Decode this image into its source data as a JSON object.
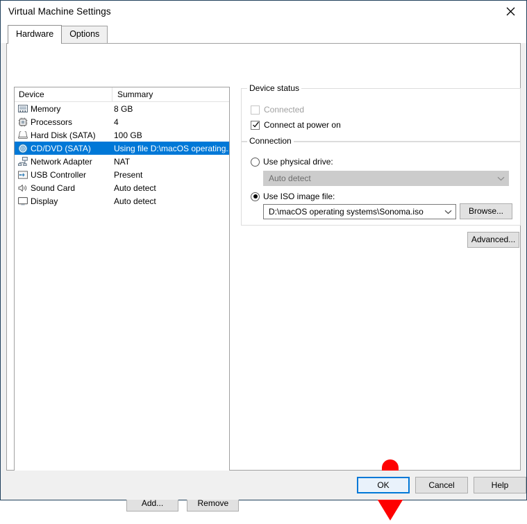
{
  "window": {
    "title": "Virtual Machine Settings",
    "close_icon": "close-icon",
    "accent_color": "#0078d7",
    "titlebar_border_color": "#20405c"
  },
  "tabs": [
    {
      "label": "Hardware",
      "active": true
    },
    {
      "label": "Options",
      "active": false
    }
  ],
  "device_list": {
    "columns": [
      "Device",
      "Summary"
    ],
    "rows": [
      {
        "icon": "memory-icon",
        "device": "Memory",
        "summary": "8 GB",
        "selected": false
      },
      {
        "icon": "processor-icon",
        "device": "Processors",
        "summary": "4",
        "selected": false
      },
      {
        "icon": "hard-disk-icon",
        "device": "Hard Disk (SATA)",
        "summary": "100 GB",
        "selected": false
      },
      {
        "icon": "cd-dvd-icon",
        "device": "CD/DVD (SATA)",
        "summary": "Using file D:\\macOS operating...",
        "selected": true
      },
      {
        "icon": "network-adapter-icon",
        "device": "Network Adapter",
        "summary": "NAT",
        "selected": false
      },
      {
        "icon": "usb-controller-icon",
        "device": "USB Controller",
        "summary": "Present",
        "selected": false
      },
      {
        "icon": "sound-card-icon",
        "device": "Sound Card",
        "summary": "Auto detect",
        "selected": false
      },
      {
        "icon": "display-icon",
        "device": "Display",
        "summary": "Auto detect",
        "selected": false
      }
    ],
    "add_label": "Add...",
    "remove_label": "Remove"
  },
  "device_status": {
    "group_title": "Device status",
    "connected": {
      "label": "Connected",
      "checked": false,
      "enabled": false
    },
    "connect_at_power_on": {
      "label": "Connect at power on",
      "checked": true,
      "enabled": true
    }
  },
  "connection": {
    "group_title": "Connection",
    "use_physical_drive": {
      "label": "Use physical drive:",
      "selected": false
    },
    "physical_drive_value": "Auto detect",
    "use_iso_image": {
      "label": "Use ISO image file:",
      "selected": true
    },
    "iso_path": "D:\\macOS operating systems\\Sonoma.iso",
    "browse_label": "Browse...",
    "advanced_label": "Advanced..."
  },
  "footer": {
    "ok_label": "OK",
    "cancel_label": "Cancel",
    "help_label": "Help"
  },
  "annotation": {
    "arrow": "down-arrow-annotation",
    "color": "#fe0000",
    "points_at": "OK"
  }
}
